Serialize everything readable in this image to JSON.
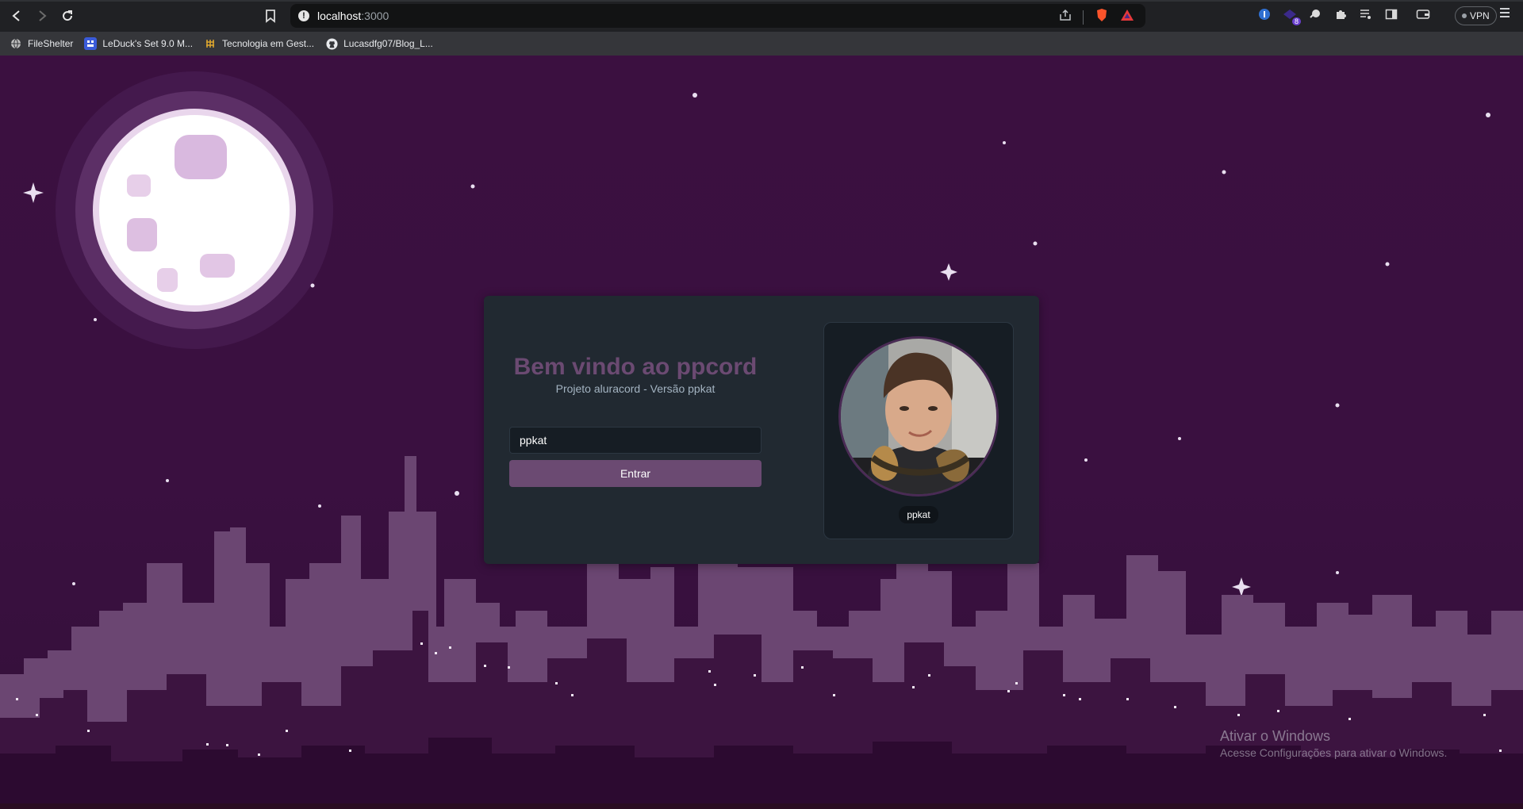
{
  "browser": {
    "url_host": "localhost",
    "url_port": ":3000",
    "vpn_label": "VPN",
    "extension_badge": "8",
    "icons": [
      "back-icon",
      "forward-icon",
      "reload-icon",
      "bookmark-icon",
      "info-icon",
      "share-icon",
      "brave-shield-icon",
      "brave-rewards-icon",
      "extension-icons",
      "puzzle-icon",
      "playlist-icon",
      "sidebar-icon",
      "wallet-icon",
      "menu-icon"
    ]
  },
  "bookmarks": [
    {
      "label": "FileShelter",
      "icon": "globe-icon"
    },
    {
      "label": "LeDuck's Set 9.0 M...",
      "icon": "set-icon"
    },
    {
      "label": "Tecnologia em Gest...",
      "icon": "tech-icon"
    },
    {
      "label": "Lucasdfg07/Blog_L...",
      "icon": "github-icon"
    }
  ],
  "login": {
    "title": "Bem vindo ao ppcord",
    "subtitle": "Projeto aluracord - Versão ppkat",
    "username_value": "ppkat",
    "submit_label": "Entrar"
  },
  "profile": {
    "username": "ppkat"
  },
  "watermark": {
    "title": "Ativar o Windows",
    "subtitle": "Acesse Configurações para ativar o Windows."
  },
  "colors": {
    "background": "#3a103f",
    "card": "#212931",
    "accent": "#6b4a72",
    "subtitle": "#a3b3c1",
    "panel": "#161d24",
    "building": "#6b4672",
    "building_dark": "#2c0a30"
  }
}
